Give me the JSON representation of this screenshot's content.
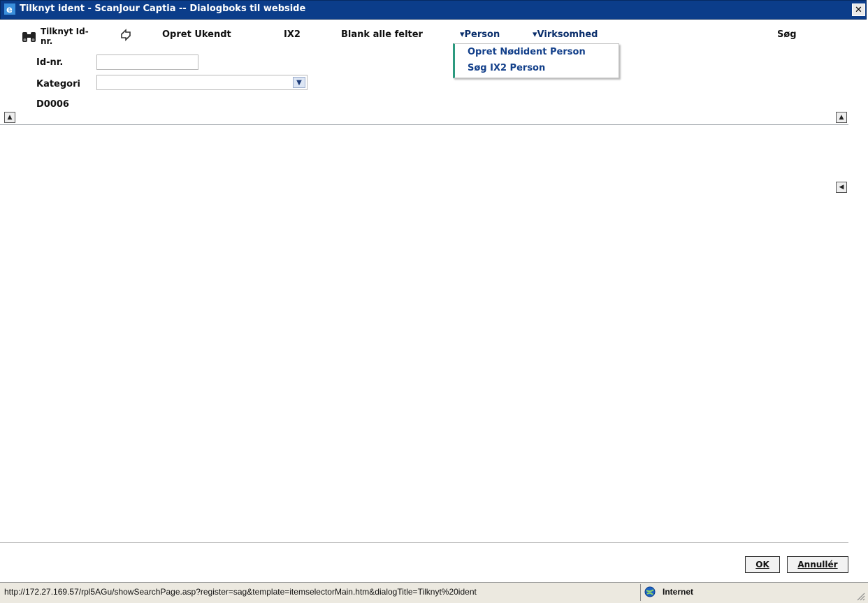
{
  "window": {
    "title": "Tilknyt ident - ScanJour Captia -- Dialogboks til webside",
    "close_label": "✕"
  },
  "toolbar": {
    "tilknyt_label_line1": "Tilknyt Id-",
    "tilknyt_label_line2": "nr.",
    "opret_ukendt": "Opret Ukendt",
    "ix2": "IX2",
    "blank_alle_felter": "Blank alle felter",
    "person": "▾Person",
    "virksomhed": "▾Virksomhed",
    "sog": "Søg"
  },
  "person_menu": {
    "items": [
      "Opret Nødident Person",
      "Søg IX2 Person"
    ],
    "accent_color": "#2c9a7f"
  },
  "form": {
    "id_label": "Id-nr.",
    "id_value": "",
    "kategori_label": "Kategori",
    "kategori_value": "",
    "code": "D0006"
  },
  "buttons": {
    "ok": "OK",
    "cancel": "Annullér"
  },
  "statusbar": {
    "url": "http://172.27.169.57/rpl5AGu/showSearchPage.asp?register=sag&template=itemselectorMain.htm&dialogTitle=Tilknyt%20ident",
    "zone": "Internet"
  },
  "colors": {
    "titlebar": "#0b3d8a",
    "menu_link": "#123f8a"
  },
  "icons": {
    "title": "ie-window-icon",
    "toolbar_1": "binoculars-icon",
    "toolbar_2": "swap-arrows-icon",
    "status": "globe-icon"
  }
}
